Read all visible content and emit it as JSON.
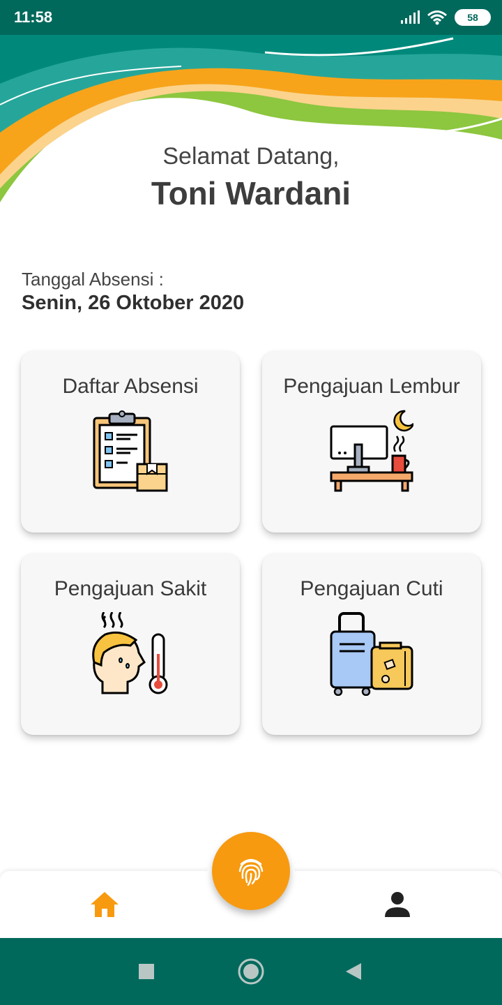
{
  "status_bar": {
    "time": "11:58",
    "battery": "58",
    "icons": [
      "signal-icon",
      "wifi-icon",
      "battery-icon"
    ]
  },
  "header": {
    "welcome": "Selamat Datang,",
    "user_name": "Toni Wardani"
  },
  "attendance": {
    "label": "Tanggal Absensi :",
    "date": "Senin, 26 Oktober 2020"
  },
  "menu": [
    {
      "title": "Daftar Absensi",
      "icon": "clipboard-checklist-icon"
    },
    {
      "title": "Pengajuan Lembur",
      "icon": "desk-night-overtime-icon"
    },
    {
      "title": "Pengajuan Sakit",
      "icon": "sick-fever-thermometer-icon"
    },
    {
      "title": "Pengajuan Cuti",
      "icon": "luggage-suitcase-icon"
    }
  ],
  "bottom_nav": {
    "items": [
      "home-icon",
      "fingerprint-icon",
      "profile-icon"
    ],
    "active": "home-icon"
  },
  "colors": {
    "primary": "#00695c",
    "accent": "#f79a10",
    "card_bg": "#f7f7f7"
  }
}
